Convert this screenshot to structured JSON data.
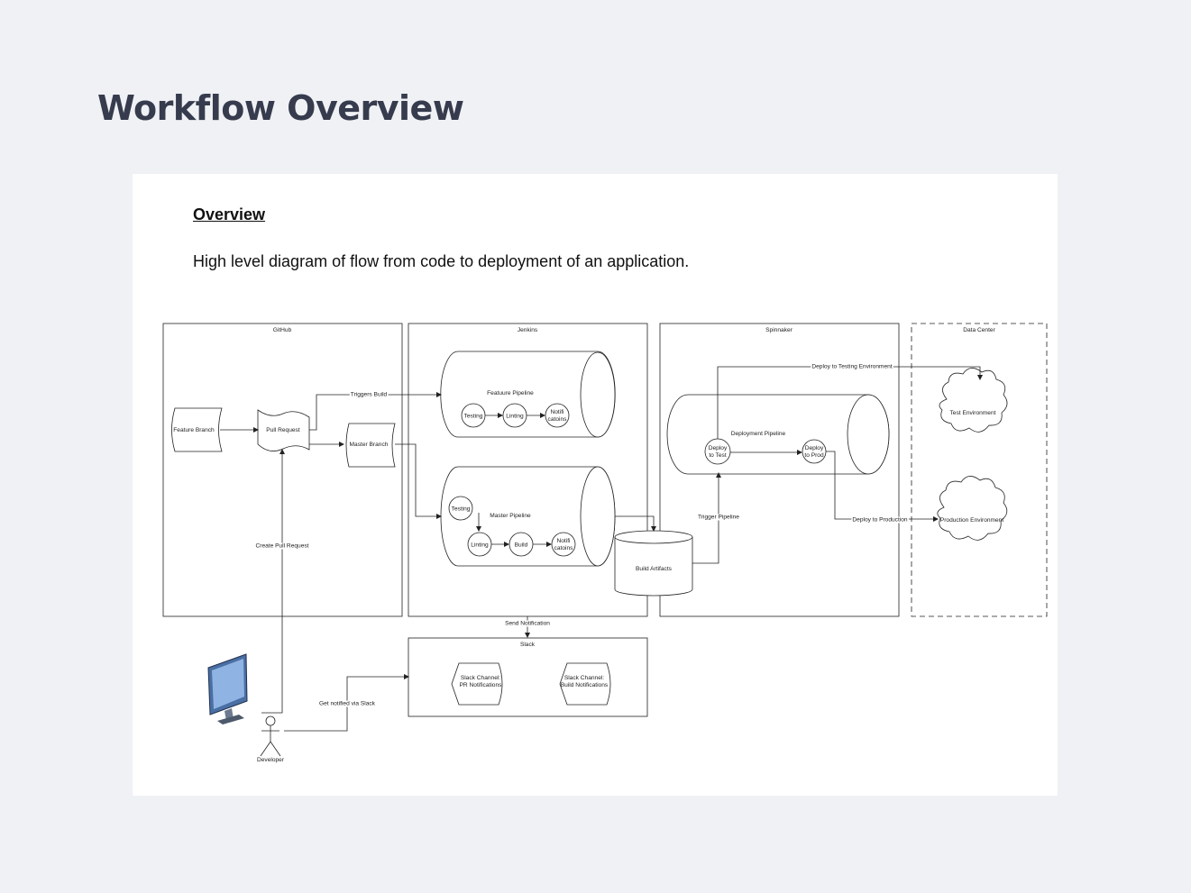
{
  "page": {
    "title": "Workflow Overview"
  },
  "content": {
    "heading": "Overview",
    "description": "High level diagram of flow from code to deployment of an application."
  },
  "diagram": {
    "containers": {
      "github": "GitHub",
      "jenkins": "Jenkins",
      "spinnaker": "Spinnaker",
      "data_center": "Data Center",
      "slack": "Slack"
    },
    "nodes": {
      "feature_branch": "Feature Branch",
      "pull_request": "Pull Request",
      "master_branch": "Master Branch",
      "feature_pipeline": "Featuure Pipeline",
      "master_pipeline": "Master Pipeline",
      "testing": "Testing",
      "linting": "Linting",
      "build": "Build",
      "notifications_line1": "Notifi",
      "notifications_line2": "catoins",
      "build_artifacts": "Build Artifacts",
      "deployment_pipeline": "Deployment Pipeline",
      "deploy_test_line1": "Deploy",
      "deploy_test_line2": "to Test",
      "deploy_prod_line1": "Deploy",
      "deploy_prod_line2": "to Prod",
      "test_environment": "Test Environment",
      "production_environment": "Production Environment",
      "slack_pr_line1": "Slack Channel:",
      "slack_pr_line2": "PR Notifications",
      "slack_build_line1": "Slack Channel:",
      "slack_build_line2": "Build Notifications",
      "developer": "Developer"
    },
    "edges": {
      "triggers_build": "Triggers Build",
      "deploy_to_testing": "Deploy to Testing Environment",
      "trigger_pipeline": "Trigger Pipeline",
      "deploy_to_production": "Deploy to Production",
      "create_pull_request": "Create Pull Request",
      "send_notification": "Send Notification",
      "get_notified": "Get notified via Slack"
    }
  }
}
